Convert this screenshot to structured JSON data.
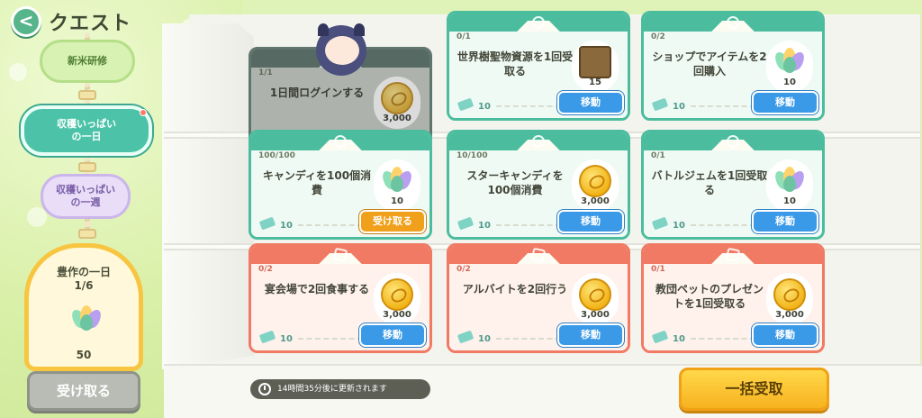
{
  "header": {
    "back_icon": "chevron-left-icon",
    "back_glyph": "<",
    "title": "クエスト"
  },
  "side_tabs": [
    {
      "label": "新米研修"
    },
    {
      "label": "収穫いっぱい\nの一日",
      "badge": true
    },
    {
      "label": "収穫いっぱい\nの一週"
    }
  ],
  "reward_card": {
    "title": "豊作の一日",
    "progress": "1/6",
    "icon": "leaf-candy-icon",
    "amount": "50",
    "button_label": "受け取る"
  },
  "timer": {
    "text": "14時間35分後に更新されます"
  },
  "claim_all": {
    "label": "一括受取"
  },
  "quests": [
    {
      "progress": "1/1",
      "desc": "1日間ログインする",
      "reward_icon": "coin-icon",
      "reward_value": "3,000",
      "ticket_value": "",
      "button": "",
      "theme": "teal",
      "state": "done"
    },
    {
      "progress": "0/1",
      "desc": "世界樹聖物資源を1回受取る",
      "reward_icon": "book-icon",
      "reward_value": "15",
      "ticket_value": "10",
      "button": "移動",
      "theme": "teal"
    },
    {
      "progress": "0/2",
      "desc": "ショップでアイテムを2回購入",
      "reward_icon": "leaf-candy-icon",
      "reward_value": "10",
      "ticket_value": "10",
      "button": "移動",
      "theme": "teal"
    },
    {
      "progress": "100/100",
      "desc": "キャンディを100個消費",
      "reward_icon": "leaf-candy-icon",
      "reward_value": "10",
      "ticket_value": "10",
      "button": "受け取る",
      "theme": "teal"
    },
    {
      "progress": "10/100",
      "desc": "スターキャンディを100個消費",
      "reward_icon": "coin-icon",
      "reward_value": "3,000",
      "ticket_value": "10",
      "button": "移動",
      "theme": "teal"
    },
    {
      "progress": "0/1",
      "desc": "バトルジェムを1回受取る",
      "reward_icon": "leaf-candy-icon",
      "reward_value": "10",
      "ticket_value": "10",
      "button": "移動",
      "theme": "teal"
    },
    {
      "progress": "0/2",
      "desc": "宴会場で2回食事する",
      "reward_icon": "coin-icon",
      "reward_value": "3,000",
      "ticket_value": "10",
      "button": "移動",
      "theme": "red"
    },
    {
      "progress": "0/2",
      "desc": "アルバイトを2回行う",
      "reward_icon": "coin-icon",
      "reward_value": "3,000",
      "ticket_value": "10",
      "button": "移動",
      "theme": "red"
    },
    {
      "progress": "0/1",
      "desc": "教団ペットのプレゼントを1回受取る",
      "reward_icon": "coin-icon",
      "reward_value": "3,000",
      "ticket_value": "10",
      "button": "移動",
      "theme": "red"
    }
  ],
  "colors": {
    "teal": "#4bbd9e",
    "red": "#f07a63",
    "move_button": "#3a9ae8",
    "claim_button": "#f0a01a",
    "claim_all": "#f7b21f"
  }
}
